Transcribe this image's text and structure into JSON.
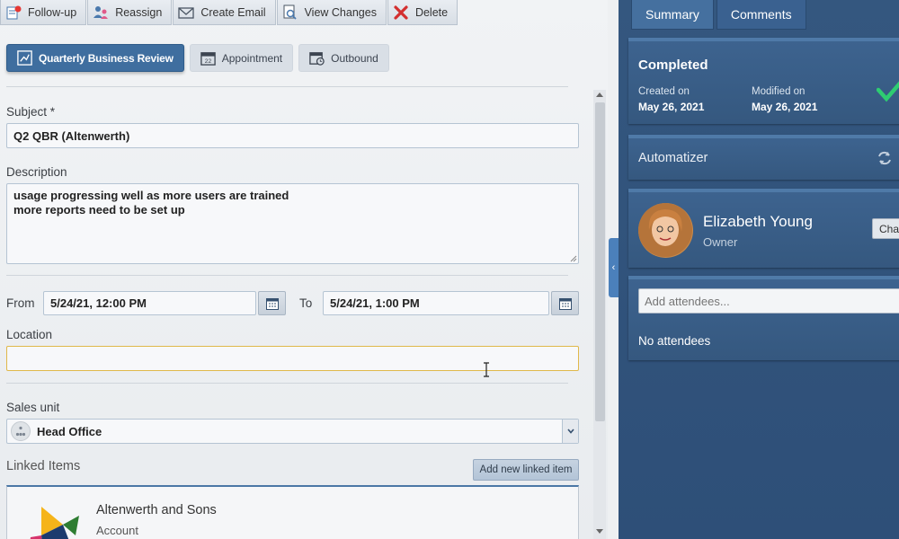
{
  "toolbar": {
    "items": [
      {
        "label": "Follow-up",
        "icon": "follow-up-icon"
      },
      {
        "label": "Reassign",
        "icon": "reassign-icon"
      },
      {
        "label": "Create Email",
        "icon": "email-icon"
      },
      {
        "label": "View Changes",
        "icon": "view-changes-icon"
      },
      {
        "label": "Delete",
        "icon": "delete-icon"
      }
    ]
  },
  "activity_types": [
    {
      "label": "Quarterly Business Review",
      "icon": "review-icon",
      "active": true
    },
    {
      "label": "Appointment",
      "icon": "calendar-icon",
      "active": false
    },
    {
      "label": "Outbound",
      "icon": "outbound-icon",
      "active": false
    }
  ],
  "form": {
    "subject_label": "Subject *",
    "subject_value": "Q2 QBR (Altenwerth)",
    "description_label": "Description",
    "description_value": "usage progressing well as more users are trained\nmore reports need to be set up",
    "from_label": "From",
    "from_value": "5/24/21, 12:00 PM",
    "to_label": "To",
    "to_value": "5/24/21, 1:00 PM",
    "location_label": "Location",
    "location_value": "",
    "sales_unit_label": "Sales unit",
    "sales_unit_value": "Head Office"
  },
  "linked": {
    "title": "Linked Items",
    "add_button": "Add new linked item",
    "items": [
      {
        "name": "Altenwerth and Sons",
        "type": "Account"
      }
    ]
  },
  "summary": {
    "tabs": [
      {
        "label": "Summary",
        "active": true
      },
      {
        "label": "Comments",
        "active": false
      }
    ],
    "status": "Completed",
    "created_label": "Created on",
    "created_value": "May 26, 2021",
    "modified_label": "Modified on",
    "modified_value": "May 26, 2021",
    "automatizer": "Automatizer",
    "owner_name": "Elizabeth Young",
    "owner_role": "Owner",
    "change_button": "Cha",
    "attendees_placeholder": "Add attendees...",
    "no_attendees": "No attendees"
  },
  "colors": {
    "accent": "#3f6e9f",
    "panel": "#2e4f78",
    "location_border": "#e0b84a",
    "check": "#2ecc71"
  }
}
